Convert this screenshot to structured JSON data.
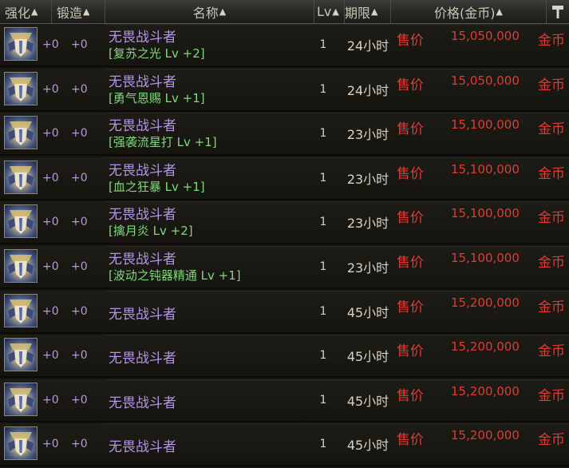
{
  "header": {
    "enhance": "强化",
    "forge": "锻造",
    "name": "名称",
    "lv": "Lv",
    "period": "期限",
    "price": "价格(金币)",
    "sort_glyph": "▲",
    "tool_icon": "hammer-icon"
  },
  "rows": [
    {
      "enhance": "+0",
      "forge": "+0",
      "name": "无畏战斗者",
      "option": "[复苏之光 Lv +2]",
      "lv": "1",
      "period": "24小时",
      "sell": "售价",
      "price": "15,050,000",
      "currency": "金币"
    },
    {
      "enhance": "+0",
      "forge": "+0",
      "name": "无畏战斗者",
      "option": "[勇气恩赐 Lv +1]",
      "lv": "1",
      "period": "24小时",
      "sell": "售价",
      "price": "15,050,000",
      "currency": "金币"
    },
    {
      "enhance": "+0",
      "forge": "+0",
      "name": "无畏战斗者",
      "option": "[强袭流星打 Lv +1]",
      "lv": "1",
      "period": "23小时",
      "sell": "售价",
      "price": "15,100,000",
      "currency": "金币"
    },
    {
      "enhance": "+0",
      "forge": "+0",
      "name": "无畏战斗者",
      "option": "[血之狂暴 Lv +1]",
      "lv": "1",
      "period": "23小时",
      "sell": "售价",
      "price": "15,100,000",
      "currency": "金币"
    },
    {
      "enhance": "+0",
      "forge": "+0",
      "name": "无畏战斗者",
      "option": "[擒月炎 Lv +2]",
      "lv": "1",
      "period": "23小时",
      "sell": "售价",
      "price": "15,100,000",
      "currency": "金币"
    },
    {
      "enhance": "+0",
      "forge": "+0",
      "name": "无畏战斗者",
      "option": "[波动之钝器精通 Lv +1]",
      "lv": "1",
      "period": "23小时",
      "sell": "售价",
      "price": "15,100,000",
      "currency": "金币"
    },
    {
      "enhance": "+0",
      "forge": "+0",
      "name": "无畏战斗者",
      "option": "",
      "lv": "1",
      "period": "45小时",
      "sell": "售价",
      "price": "15,200,000",
      "currency": "金币"
    },
    {
      "enhance": "+0",
      "forge": "+0",
      "name": "无畏战斗者",
      "option": "",
      "lv": "1",
      "period": "45小时",
      "sell": "售价",
      "price": "15,200,000",
      "currency": "金币"
    },
    {
      "enhance": "+0",
      "forge": "+0",
      "name": "无畏战斗者",
      "option": "",
      "lv": "1",
      "period": "45小时",
      "sell": "售价",
      "price": "15,200,000",
      "currency": "金币"
    },
    {
      "enhance": "+0",
      "forge": "+0",
      "name": "无畏战斗者",
      "option": "",
      "lv": "1",
      "period": "45小时",
      "sell": "售价",
      "price": "15,200,000",
      "currency": "金币"
    }
  ],
  "item_icon": "armor-item-icon"
}
